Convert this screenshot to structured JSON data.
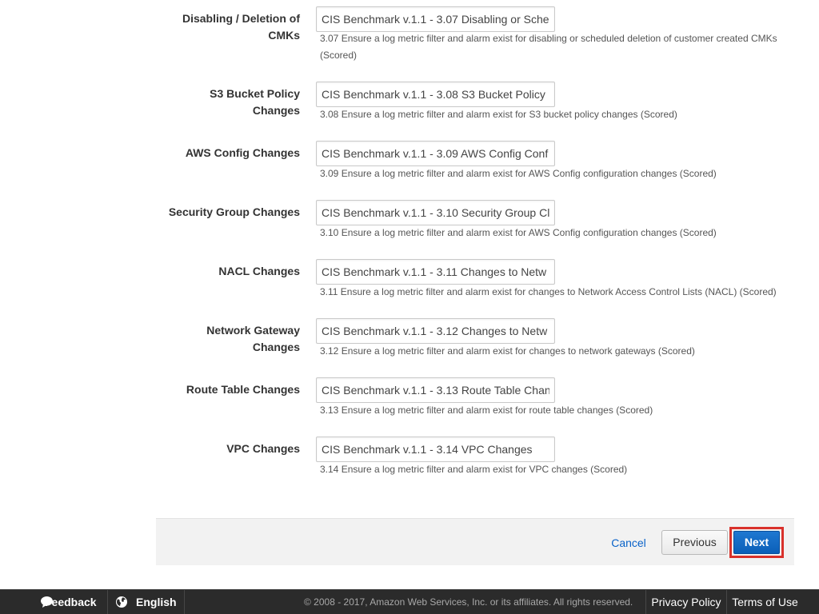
{
  "rules": [
    {
      "label": "Disabling / Deletion of CMKs",
      "value": "CIS Benchmark v.1.1 - 3.07 Disabling or Sche",
      "description": "3.07 Ensure a log metric filter and alarm exist for disabling or scheduled deletion of customer created CMKs (Scored)"
    },
    {
      "label": "S3 Bucket Policy Changes",
      "value": "CIS Benchmark v.1.1 - 3.08 S3 Bucket Policy",
      "description": "3.08 Ensure a log metric filter and alarm exist for S3 bucket policy changes (Scored)"
    },
    {
      "label": "AWS Config Changes",
      "value": "CIS Benchmark v.1.1 - 3.09 AWS Config Conf",
      "description": "3.09 Ensure a log metric filter and alarm exist for AWS Config configuration changes (Scored)"
    },
    {
      "label": "Security Group Changes",
      "value": "CIS Benchmark v.1.1 - 3.10 Security Group Cl",
      "description": "3.10 Ensure a log metric filter and alarm exist for AWS Config configuration changes (Scored)"
    },
    {
      "label": "NACL Changes",
      "value": "CIS Benchmark v.1.1 - 3.11 Changes to Netw",
      "description": "3.11 Ensure a log metric filter and alarm exist for changes to Network Access Control Lists (NACL) (Scored)"
    },
    {
      "label": "Network Gateway Changes",
      "value": "CIS Benchmark v.1.1 - 3.12 Changes to Netw",
      "description": "3.12 Ensure a log metric filter and alarm exist for changes to network gateways (Scored)"
    },
    {
      "label": "Route Table Changes",
      "value": "CIS Benchmark v.1.1 - 3.13 Route Table Chan",
      "description": "3.13 Ensure a log metric filter and alarm exist for route table changes (Scored)"
    },
    {
      "label": "VPC Changes",
      "value": "CIS Benchmark v.1.1 - 3.14 VPC Changes",
      "description": "3.14 Ensure a log metric filter and alarm exist for VPC changes (Scored)"
    }
  ],
  "actions": {
    "cancel_label": "Cancel",
    "previous_label": "Previous",
    "next_label": "Next"
  },
  "footer": {
    "feedback_label": "Feedback",
    "feedback_icon": "speech-bubble-icon",
    "language_label": "English",
    "language_icon": "globe-icon",
    "copyright": "© 2008 - 2017, Amazon Web Services, Inc. or its affiliates. All rights reserved.",
    "privacy_label": "Privacy Policy",
    "terms_label": "Terms of Use"
  },
  "colors": {
    "accent": "#0b5fb8",
    "highlight": "#d9312b",
    "footer_bg": "#2b2b2b"
  }
}
